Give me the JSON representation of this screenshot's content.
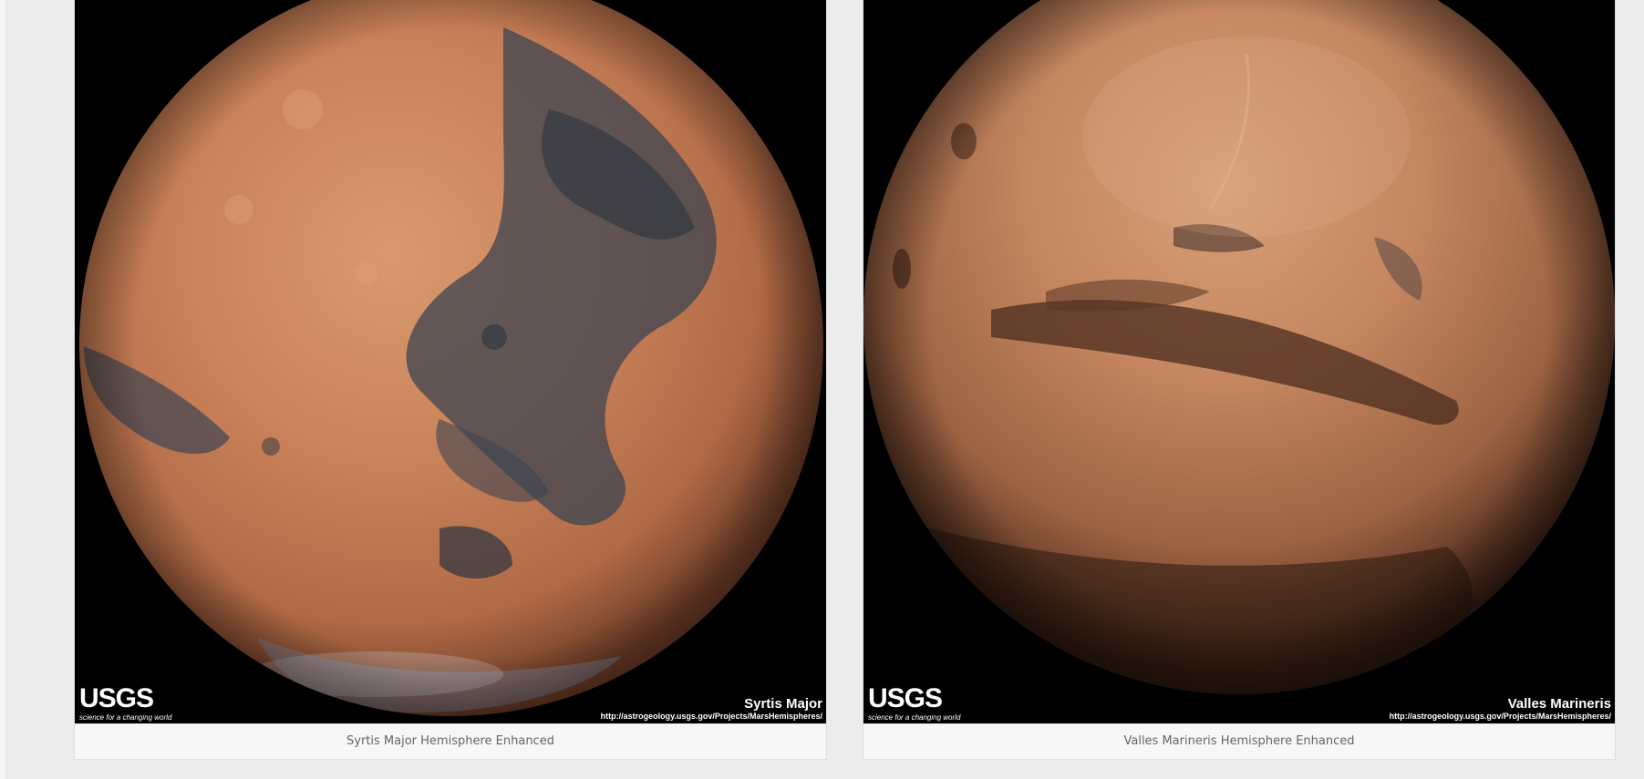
{
  "gallery": {
    "items": [
      {
        "image_overlay": {
          "logo_text": "USGS",
          "tagline": "science for a changing world",
          "title": "Syrtis Major",
          "url": "http://astrogeology.usgs.gov/Projects/MarsHemispheres/"
        },
        "caption": "Syrtis Major Hemisphere Enhanced"
      },
      {
        "image_overlay": {
          "logo_text": "USGS",
          "tagline": "science for a changing world",
          "title": "Valles Marineris",
          "url": "http://astrogeology.usgs.gov/Projects/MarsHemispheres/"
        },
        "caption": "Valles Marineris Hemisphere Enhanced"
      }
    ]
  },
  "colors": {
    "page_background": "#ececec",
    "card_background": "#f8f8f8",
    "caption_text": "#666666",
    "planet_tone": "#c37b52"
  }
}
